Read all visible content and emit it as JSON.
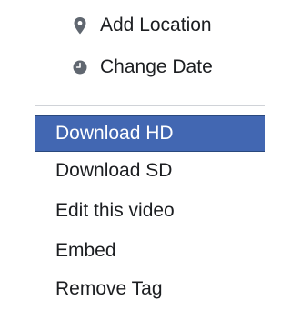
{
  "menu": {
    "icon_items": [
      {
        "label": "Add Location",
        "icon": "location-pin-icon"
      },
      {
        "label": "Change Date",
        "icon": "clock-icon"
      }
    ],
    "items": [
      {
        "label": "Download HD",
        "active": true
      },
      {
        "label": "Download SD",
        "active": false
      },
      {
        "label": "Edit this video",
        "active": false
      },
      {
        "label": "Embed",
        "active": false
      },
      {
        "label": "Remove Tag",
        "active": false
      }
    ]
  },
  "colors": {
    "highlight": "#4267b2",
    "icon": "#606770",
    "text": "#1c1e21",
    "divider": "#d0d3d8"
  }
}
